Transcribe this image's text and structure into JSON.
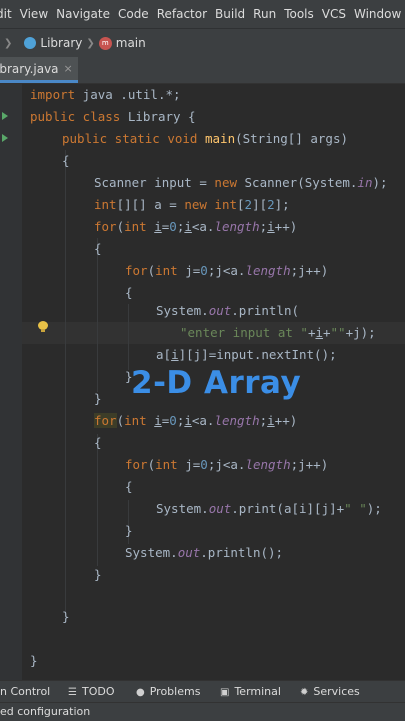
{
  "menu": [
    "dit",
    "View",
    "Navigate",
    "Code",
    "Refactor",
    "Build",
    "Run",
    "Tools",
    "VCS",
    "Window"
  ],
  "breadcrumb": {
    "project": "Library",
    "member": "main"
  },
  "tab": {
    "label": "ibrary.java",
    "close": "×"
  },
  "code": {
    "l1_import": "import",
    "l1_rest": " java .util.*;",
    "l2_public": "public class",
    "l2_name": " Library {",
    "l3_mods": "public static void ",
    "l3_main": "main",
    "l3_args": "(String[] args)",
    "l4": "{",
    "l5_a": "Scanner input = ",
    "l5_new": "new",
    "l5_b": " Scanner(System.",
    "l5_in": "in",
    "l5_c": ");",
    "l6_int": "int",
    "l6_a": "[][] a = ",
    "l6_new": "new int",
    "l6_b": "[",
    "l6_n1": "2",
    "l6_c": "][",
    "l6_n2": "2",
    "l6_d": "];",
    "l7_for": "for",
    "l7_a": "(",
    "l7_int": "int ",
    "l7_i": "i",
    "l7_b": "=",
    "l7_0": "0",
    "l7_c": ";",
    "l7_i2": "i",
    "l7_d": "<a.",
    "l7_len": "length",
    "l7_e": ";",
    "l7_i3": "i",
    "l7_f": "++)",
    "l8": "{",
    "l9_for": "for",
    "l9_a": "(",
    "l9_int": "int ",
    "l9_b": "j=",
    "l9_0": "0",
    "l9_c": ";j<a.",
    "l9_len": "length",
    "l9_d": ";j++)",
    "l10": "{",
    "l11_a": "System.",
    "l11_out": "out",
    "l11_b": ".println(",
    "l12_str": "\"enter input at \"",
    "l12_a": "+",
    "l12_i": "i",
    "l12_b": "+",
    "l12_str2": "\"\"",
    "l12_c": "+j);",
    "l13_a": "a[",
    "l13_i": "i",
    "l13_b": "][j]=input.nextInt();",
    "l14": "}",
    "l15": "}",
    "l16_for": "for",
    "l16_a": "(",
    "l16_int": "int ",
    "l16_i": "i",
    "l16_b": "=",
    "l16_0": "0",
    "l16_c": ";",
    "l16_i2": "i",
    "l16_d": "<a.",
    "l16_len": "length",
    "l16_e": ";",
    "l16_i3": "i",
    "l16_f": "++)",
    "l17": "{",
    "l18_for": "for",
    "l18_a": "(",
    "l18_int": "int ",
    "l18_b": "j=",
    "l18_0": "0",
    "l18_c": ";j<a.",
    "l18_len": "length",
    "l18_d": ";j++)",
    "l19": "{",
    "l20_a": "System.",
    "l20_out": "out",
    "l20_b": ".print(a[i][j]+",
    "l20_str": "\" \"",
    "l20_c": ");",
    "l21": "}",
    "l22_a": "System.",
    "l22_out": "out",
    "l22_b": ".println();",
    "l23": "}",
    "l24": "}",
    "l25": "}"
  },
  "overlay_title": "2-D Array",
  "tool_windows": {
    "control": "n Control",
    "todo": "TODO",
    "problems": "Problems",
    "terminal": "Terminal",
    "services": "Services"
  },
  "status": "ed configuration",
  "colors": {
    "keyword": "#cc7832",
    "string": "#6a8759",
    "number": "#6897bb",
    "method": "#ffc66d",
    "field": "#9876aa",
    "overlay": "#3b8ee6"
  }
}
